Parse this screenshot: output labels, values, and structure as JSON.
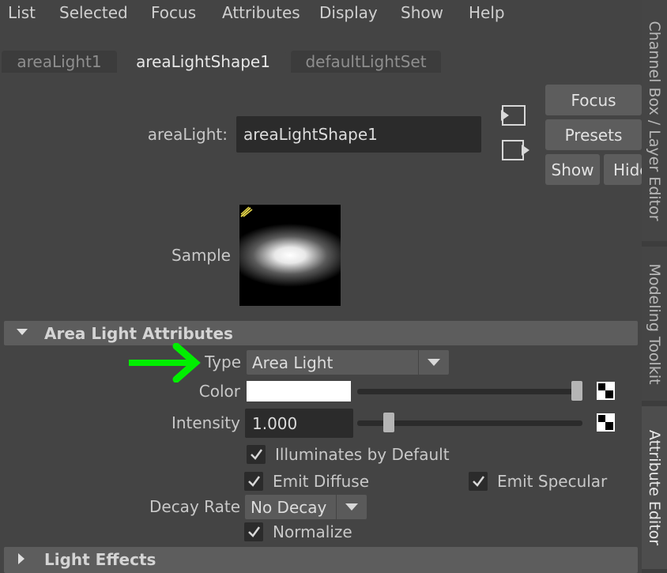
{
  "menu": [
    "List",
    "Selected",
    "Focus",
    "Attributes",
    "Display",
    "Show",
    "Help"
  ],
  "tabs": [
    {
      "label": "areaLight1",
      "active": false
    },
    {
      "label": "areaLightShape1",
      "active": true
    },
    {
      "label": "defaultLightSet",
      "active": false
    }
  ],
  "side_tabs": {
    "channel_box": "Channel Box / Layer Editor",
    "modeling_toolkit": "Modeling Toolkit",
    "attribute_editor": "Attribute Editor"
  },
  "node": {
    "type_label": "areaLight:",
    "name": "areaLightShape1"
  },
  "buttons": {
    "focus": "Focus",
    "presets": "Presets",
    "show": "Show",
    "hide": "Hide"
  },
  "sample": {
    "label": "Sample"
  },
  "sections": {
    "area_light_attributes": "Area Light Attributes",
    "light_effects": "Light Effects"
  },
  "attributes": {
    "type_label": "Type",
    "type_value": "Area Light",
    "color_label": "Color",
    "color_value": "#ffffff",
    "color_slider_fraction": 1.0,
    "intensity_label": "Intensity",
    "intensity_value": "1.000",
    "intensity_slider_fraction": 0.12,
    "illuminates_default": {
      "label": "Illuminates by Default",
      "checked": true
    },
    "emit_diffuse": {
      "label": "Emit Diffuse",
      "checked": true
    },
    "emit_specular": {
      "label": "Emit Specular",
      "checked": true
    },
    "decay_rate_label": "Decay Rate",
    "decay_rate_value": "No Decay",
    "normalize": {
      "label": "Normalize",
      "checked": true
    }
  },
  "annotation": {
    "arrow_color": "#00ee00"
  }
}
